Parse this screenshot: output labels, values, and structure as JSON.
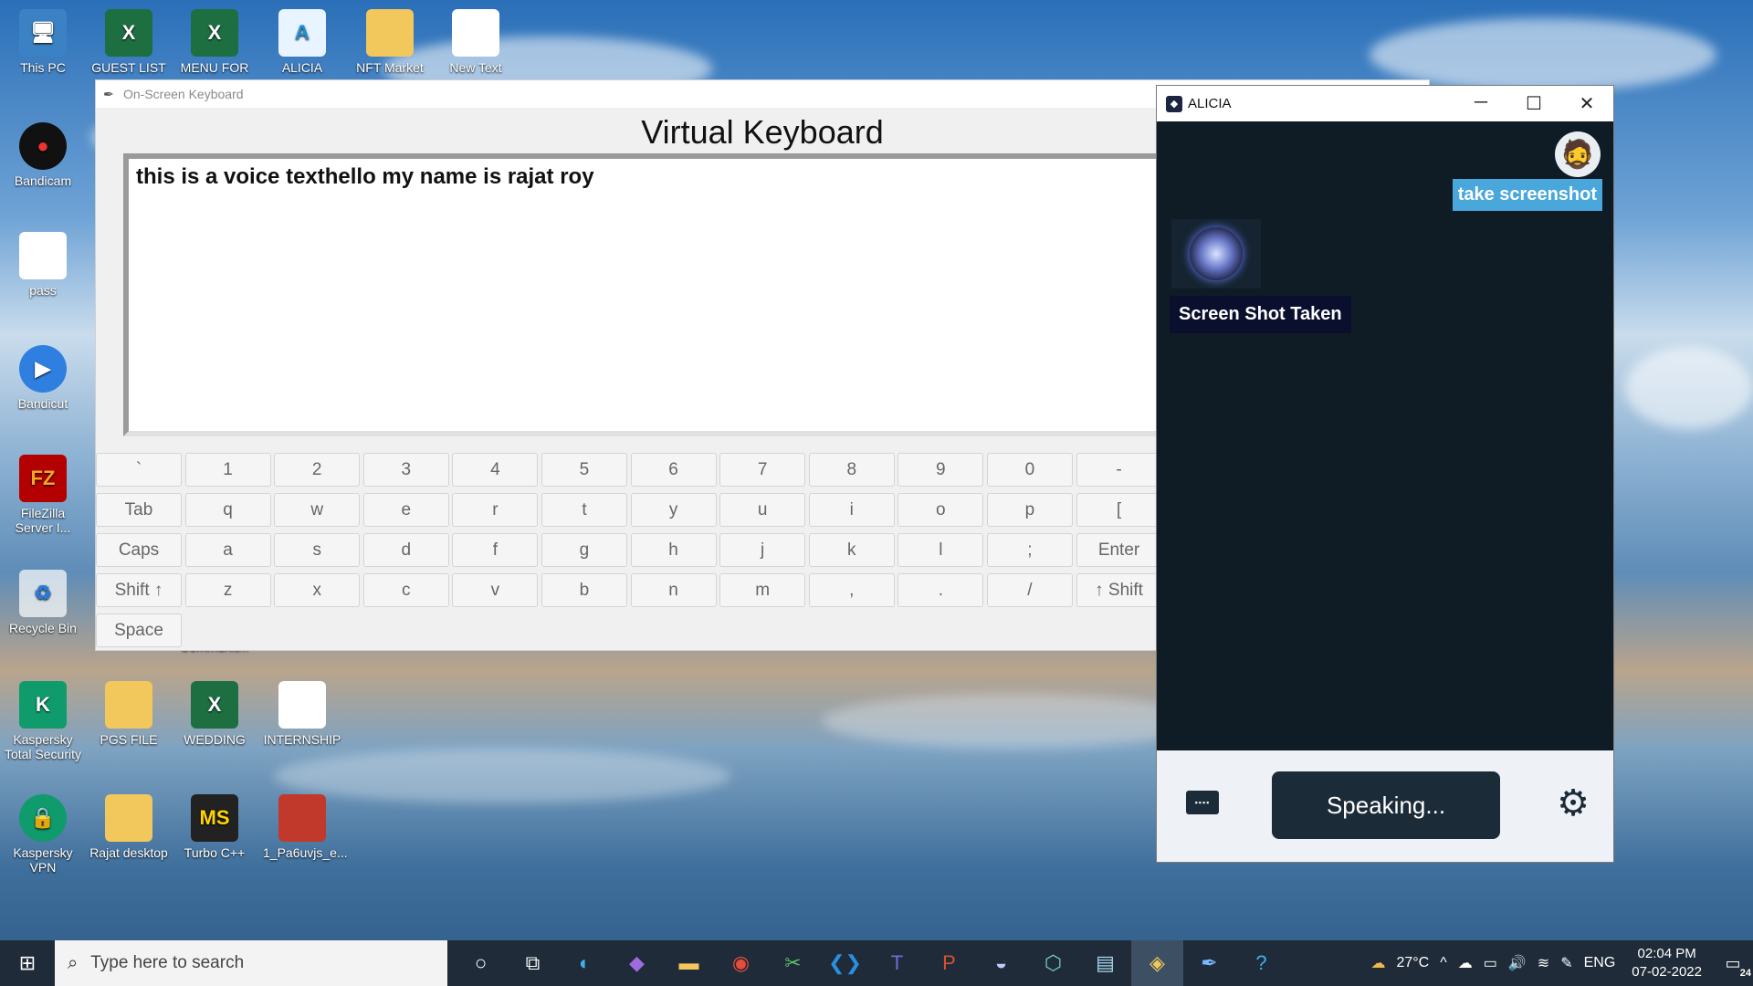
{
  "desktop_icons": [
    {
      "label": "This PC"
    },
    {
      "label": "GUEST LIST"
    },
    {
      "label": "MENU FOR"
    },
    {
      "label": "ALICIA"
    },
    {
      "label": "NFT Market"
    },
    {
      "label": "New Text"
    },
    {
      "label": "Bandicam"
    },
    {
      "label": "pass"
    },
    {
      "label": "Bandicut"
    },
    {
      "label": "FileZilla Server I..."
    },
    {
      "label": "Recycle Bin"
    },
    {
      "label": "Communit..."
    },
    {
      "label": "Kaspersky Total Security"
    },
    {
      "label": "PGS FILE"
    },
    {
      "label": "WEDDING"
    },
    {
      "label": "INTERNSHIP"
    },
    {
      "label": "Kaspersky VPN"
    },
    {
      "label": "Rajat desktop"
    },
    {
      "label": "Turbo C++"
    },
    {
      "label": "1_Pa6uvjs_e..."
    }
  ],
  "osk": {
    "window_title": "On-Screen Keyboard",
    "heading": "Virtual Keyboard",
    "text": "this is a voice texthello my name is rajat roy",
    "rows": [
      [
        "`",
        "1",
        "2",
        "3",
        "4",
        "5",
        "6",
        "7",
        "8",
        "9",
        "0",
        "-"
      ],
      [
        "Tab",
        "q",
        "w",
        "e",
        "r",
        "t",
        "y",
        "u",
        "i",
        "o",
        "p",
        "["
      ],
      [
        "Caps",
        "a",
        "s",
        "d",
        "f",
        "g",
        "h",
        "j",
        "k",
        "l",
        ";",
        "Enter"
      ],
      [
        "Shift ↑",
        "z",
        "x",
        "c",
        "v",
        "b",
        "n",
        "m",
        ",",
        ".",
        "/",
        "↑ Shift"
      ],
      [
        "Space"
      ]
    ]
  },
  "alicia": {
    "window_title": "ALICIA",
    "controls": {
      "minimize": "─",
      "maximize": "☐",
      "close": "✕"
    },
    "user_message": "take screenshot",
    "bot_message": "Screen Shot Taken",
    "speak_button": "Speaking..."
  },
  "taskbar": {
    "search_placeholder": "Type here to search",
    "temperature": "27°C",
    "language": "ENG",
    "time": "02:04 PM",
    "date": "07-02-2022",
    "notification_count": "24"
  }
}
